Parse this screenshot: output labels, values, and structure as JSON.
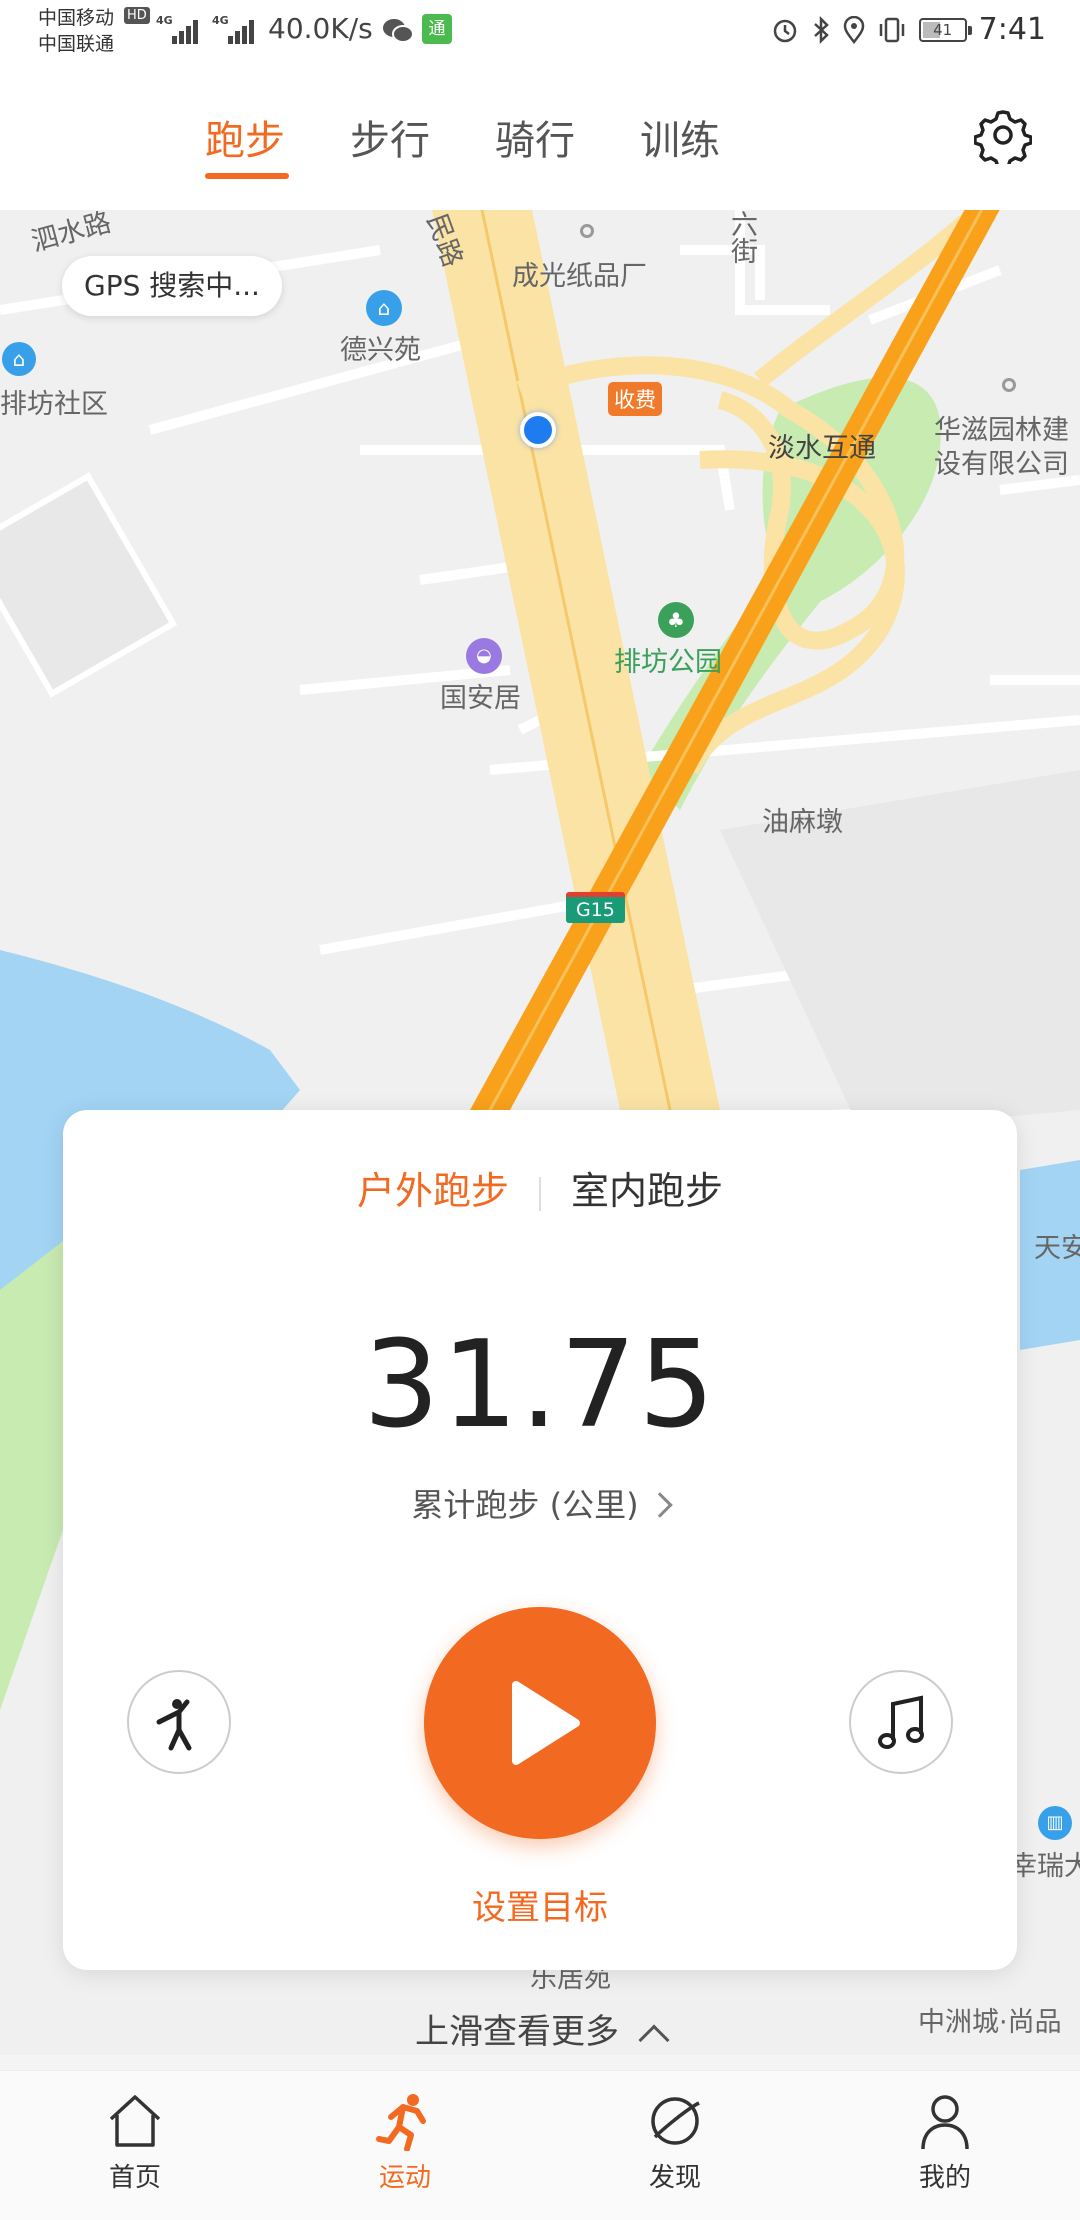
{
  "status_bar": {
    "carrier_1": "中国移动",
    "carrier_2": "中国联通",
    "hd": "HD",
    "net_type": "4G",
    "net_speed": "40.0K/s",
    "app_badge": "通",
    "battery": "41",
    "time": "7:41"
  },
  "top_tabs": {
    "active_index": 0,
    "items": [
      "跑步",
      "步行",
      "骑行",
      "训练"
    ]
  },
  "map": {
    "gps_status": "GPS 搜索中...",
    "labels": {
      "road_top_left": "泗水路",
      "road_top_center": "民路",
      "street_top": "六街",
      "paper_factory": "成光纸品厂",
      "dexing_yuan": "德兴苑",
      "community": "排坊社区",
      "toll": "收费",
      "interchange": "淡水互通",
      "company_1": "华滋园林建",
      "company_2": "设有限公司",
      "park": "排坊公园",
      "guoan_ju": "国安居",
      "youma_dun": "油麻墩",
      "highway": "G15",
      "tian": "天安",
      "rui": "幸瑞大",
      "le_ju": "乐居苑",
      "zhongzhou": "中洲城·尚品"
    }
  },
  "card": {
    "mode_tabs": [
      "户外跑步",
      "室内跑步"
    ],
    "active_mode": 0,
    "distance": "31.75",
    "distance_label": "累计跑步 (公里)",
    "left_button": "warmup-icon",
    "right_button": "music-icon",
    "start_button": "play-icon",
    "set_goal": "设置目标"
  },
  "slide_hint": "上滑查看更多",
  "bottom_nav": {
    "active_index": 1,
    "items": [
      {
        "label": "首页",
        "icon": "home-icon"
      },
      {
        "label": "运动",
        "icon": "running-icon"
      },
      {
        "label": "发现",
        "icon": "planet-icon"
      },
      {
        "label": "我的",
        "icon": "user-icon"
      }
    ]
  },
  "colors": {
    "accent": "#f26a21",
    "highway": "#f9a11b",
    "road": "#fbe3a6",
    "water": "#a3d4f4",
    "green": "#c8ebb1"
  }
}
